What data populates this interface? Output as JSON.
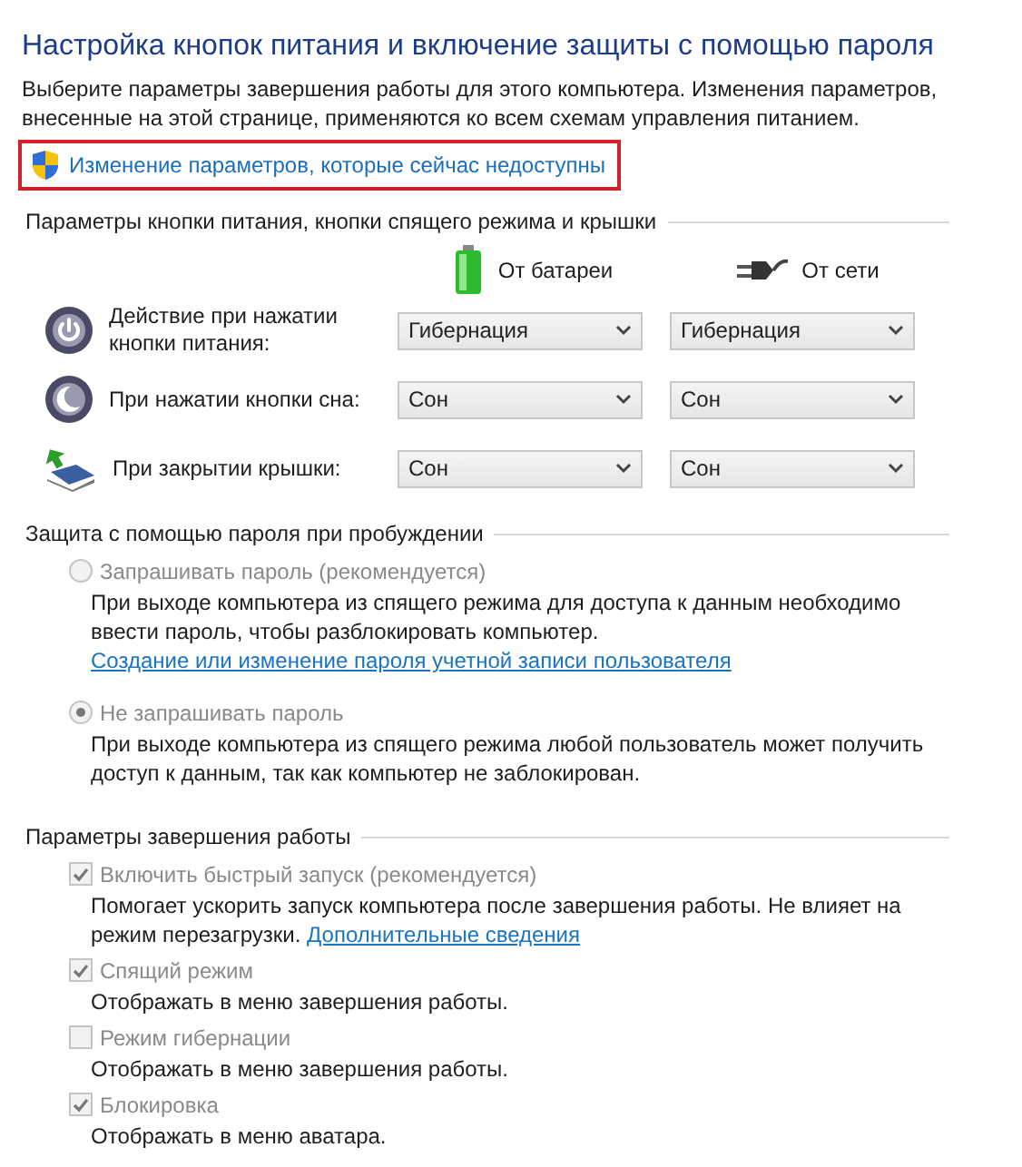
{
  "title": "Настройка кнопок питания и включение защиты с помощью пароля",
  "intro": "Выберите параметры завершения работы для этого компьютера. Изменения параметров, внесенные на этой странице, применяются ко всем схемам управления питанием.",
  "admin_link": {
    "text": "Изменение параметров, которые сейчас недоступны",
    "highlighted": true
  },
  "power_buttons": {
    "heading": "Параметры кнопки питания, кнопки спящего режима и крышки",
    "columns": [
      {
        "kind": "battery",
        "label": "От батареи"
      },
      {
        "kind": "plug",
        "label": "От сети"
      }
    ],
    "rows": [
      {
        "kind": "power",
        "label": "Действие при нажатии кнопки питания:",
        "values": [
          "Гибернация",
          "Гибернация"
        ]
      },
      {
        "kind": "sleep",
        "label": "При нажатии кнопки сна:",
        "values": [
          "Сон",
          "Сон"
        ]
      },
      {
        "kind": "lid",
        "label": "При закрытии крышки:",
        "values": [
          "Сон",
          "Сон"
        ]
      }
    ]
  },
  "password": {
    "heading": "Защита с помощью пароля при пробуждении",
    "options": [
      {
        "label": "Запрашивать пароль (рекомендуется)",
        "description": "При выходе компьютера из спящего режима для доступа к данным необходимо ввести пароль, чтобы разблокировать компьютер.",
        "link": "Создание или изменение пароля учетной записи пользователя",
        "selected": false,
        "disabled": true
      },
      {
        "label": "Не запрашивать пароль",
        "description": "При выходе компьютера из спящего режима любой пользователь может получить доступ к данным, так как компьютер не заблокирован.",
        "selected": true,
        "disabled": true
      }
    ]
  },
  "shutdown": {
    "heading": "Параметры завершения работы",
    "items": [
      {
        "label": "Включить быстрый запуск (рекомендуется)",
        "description": "Помогает ускорить запуск компьютера после завершения работы. Не влияет на режим перезагрузки.",
        "link": "Дополнительные сведения",
        "checked": true,
        "disabled": true
      },
      {
        "label": "Спящий режим",
        "description": "Отображать в меню завершения работы.",
        "checked": true,
        "disabled": true
      },
      {
        "label": "Режим гибернации",
        "description": "Отображать в меню завершения работы.",
        "checked": false,
        "disabled": true
      },
      {
        "label": "Блокировка",
        "description": "Отображать в меню аватара.",
        "checked": true,
        "disabled": true
      }
    ]
  }
}
